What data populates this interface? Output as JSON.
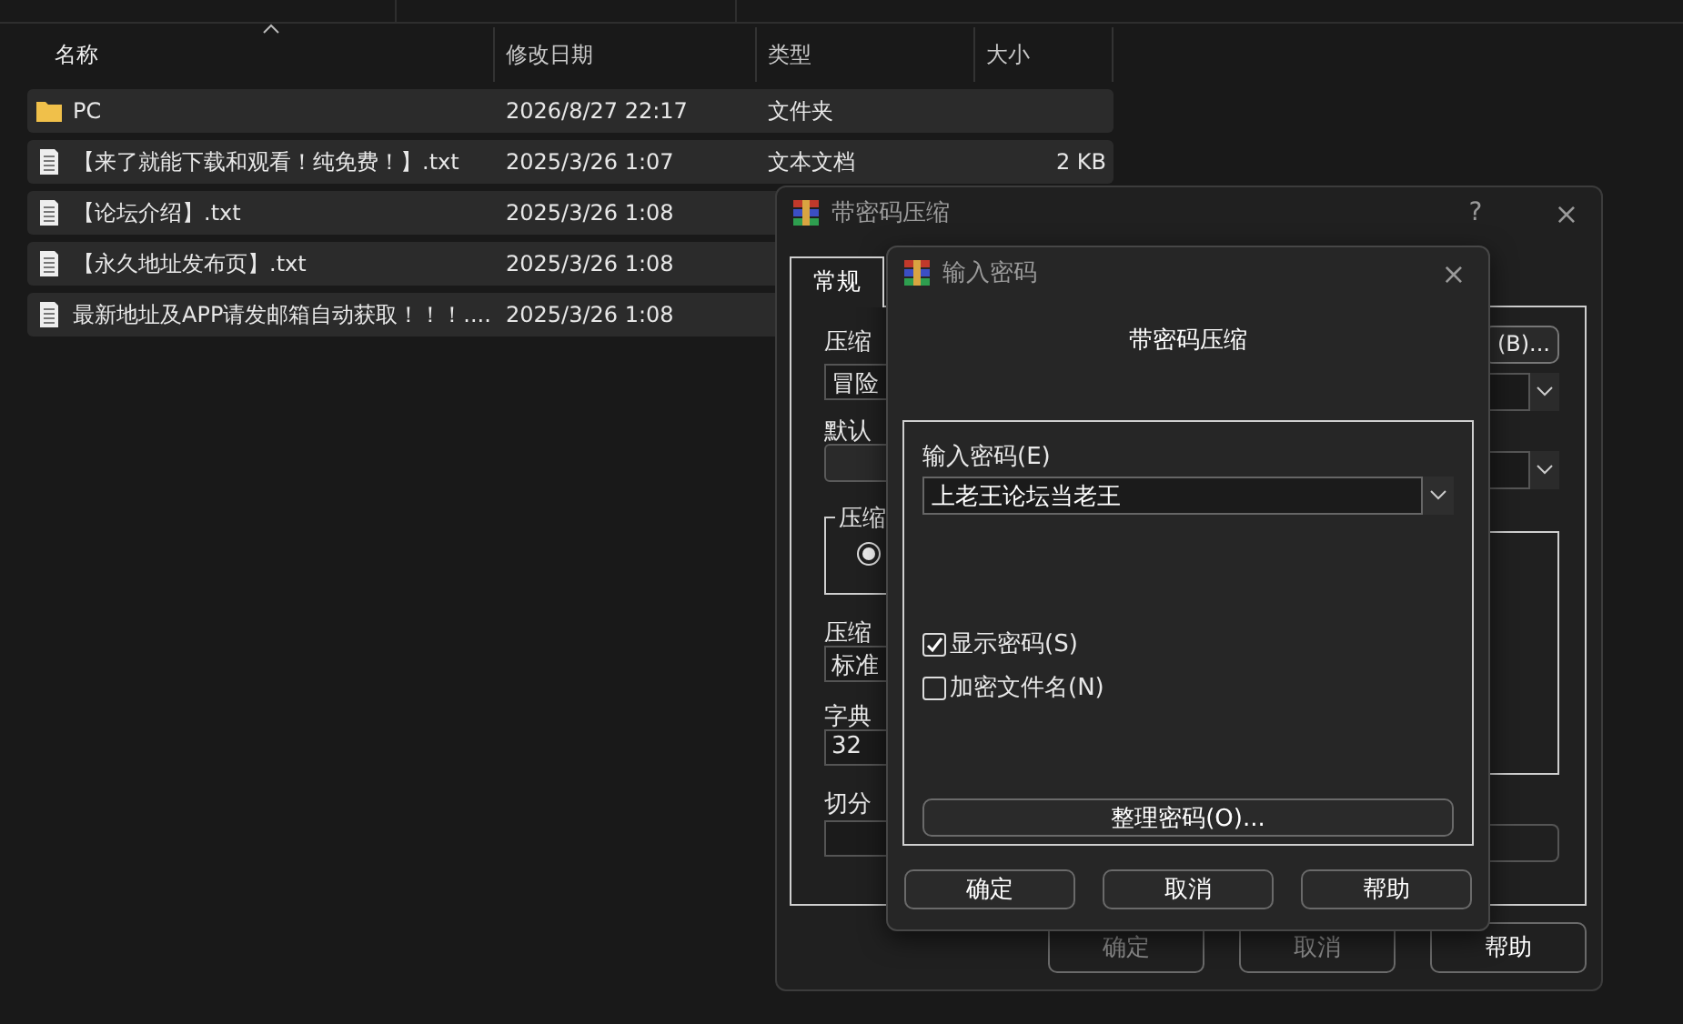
{
  "explorer": {
    "columns": [
      {
        "label": "名称",
        "sorted": true
      },
      {
        "label": "修改日期",
        "sorted": false
      },
      {
        "label": "类型",
        "sorted": false
      },
      {
        "label": "大小",
        "sorted": false
      }
    ],
    "rows": [
      {
        "kind": "folder",
        "name": "PC",
        "modified": "2026/8/27 22:17",
        "type": "文件夹",
        "selected": true
      },
      {
        "kind": "file",
        "name": "【来了就能下载和观看！纯免费！】.txt",
        "modified": "2025/3/26 1:07",
        "type": "文本文档",
        "size": "2 KB",
        "selected": true
      },
      {
        "kind": "file",
        "name": "【论坛介绍】.txt",
        "modified": "2025/3/26 1:08",
        "selected": true
      },
      {
        "kind": "file",
        "name": "【永久地址发布页】.txt",
        "modified": "2025/3/26 1:08",
        "selected": true
      },
      {
        "kind": "file",
        "name": "最新地址及APP请发邮箱自动获取！！！....",
        "modified": "2025/3/26 1:08",
        "selected": true
      }
    ]
  },
  "back_dialog": {
    "title": "带密码压缩",
    "help": "?",
    "close": "×",
    "tabs": [
      {
        "label": "常规",
        "selected": true
      }
    ],
    "left": [
      {
        "kind": "label",
        "text": "压缩"
      },
      {
        "kind": "field",
        "text": "冒险"
      },
      {
        "kind": "label",
        "text": "默认"
      },
      {
        "kind": "combo"
      },
      {
        "kind": "group",
        "text": "压缩",
        "radio_selected": true
      },
      {
        "kind": "label",
        "text": "压缩"
      },
      {
        "kind": "field",
        "text": "标准"
      },
      {
        "kind": "label",
        "text": "字典"
      },
      {
        "kind": "field",
        "text": "32"
      },
      {
        "kind": "label",
        "text": "切分"
      },
      {
        "kind": "field"
      }
    ],
    "browse_button": "(B)...",
    "buttons": [
      {
        "label": "确定",
        "disabled": true
      },
      {
        "label": "取消",
        "disabled": true
      },
      {
        "label": "帮助",
        "disabled": false
      }
    ]
  },
  "front_dialog": {
    "title": "输入密码",
    "close": "×",
    "heading": "带密码压缩",
    "password_label": "输入密码(E)",
    "password_value": "上老王论坛当老王",
    "checkboxes": [
      {
        "label": "显示密码(S)",
        "checked": true
      },
      {
        "label": "加密文件名(N)",
        "checked": false
      }
    ],
    "manage_button": "整理密码(O)...",
    "buttons": [
      {
        "label": "确定"
      },
      {
        "label": "取消"
      },
      {
        "label": "帮助"
      }
    ]
  }
}
